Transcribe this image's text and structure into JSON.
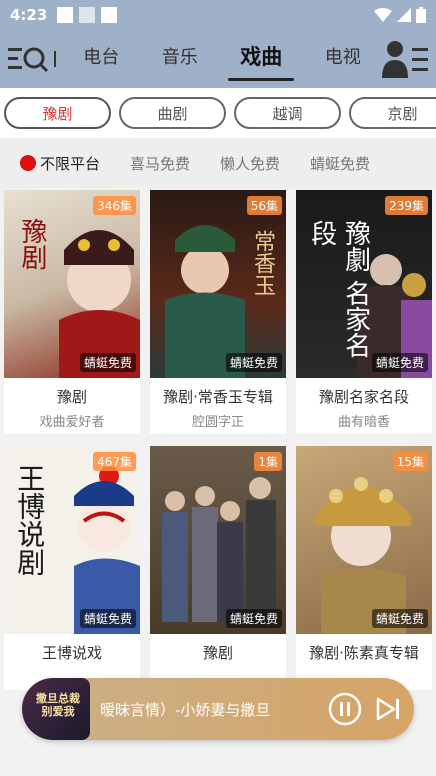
{
  "status": {
    "time": "4:23"
  },
  "topnav": {
    "tabs": [
      {
        "label": "电台"
      },
      {
        "label": "音乐"
      },
      {
        "label": "戏曲"
      },
      {
        "label": "电视"
      }
    ],
    "active": "戏曲"
  },
  "subtabs": [
    {
      "label": "豫剧"
    },
    {
      "label": "曲剧"
    },
    {
      "label": "越调"
    },
    {
      "label": "京剧"
    }
  ],
  "filters": [
    {
      "label": "不限平台"
    },
    {
      "label": "喜马免费"
    },
    {
      "label": "懒人免费"
    },
    {
      "label": "蜻蜓免费"
    }
  ],
  "cards": [
    {
      "count": "346集",
      "badge": "蜻蜓免费",
      "title": "豫剧",
      "subtitle": "戏曲爱好者",
      "art": "豫剧"
    },
    {
      "count": "56集",
      "badge": "蜻蜓免费",
      "title": "豫剧·常香玉专辑",
      "subtitle": "腔圆字正",
      "art": "常香玉"
    },
    {
      "count": "239集",
      "badge": "蜻蜓免费",
      "title": "豫剧名家名段",
      "subtitle": "曲有暗香",
      "art": "豫劇 名家名段"
    },
    {
      "count": "467集",
      "badge": "蜻蜓免费",
      "title": "王博说戏",
      "subtitle": "",
      "art": "王博说剧"
    },
    {
      "count": "1集",
      "badge": "蜻蜓免费",
      "title": "豫剧",
      "subtitle": "",
      "art": ""
    },
    {
      "count": "15集",
      "badge": "蜻蜓免费",
      "title": "豫剧·陈素真专辑",
      "subtitle": "",
      "art": ""
    }
  ],
  "player": {
    "text": "暧昧言情）-小娇妻与撒旦",
    "cover_text": "撒旦总裁 别爱我"
  }
}
